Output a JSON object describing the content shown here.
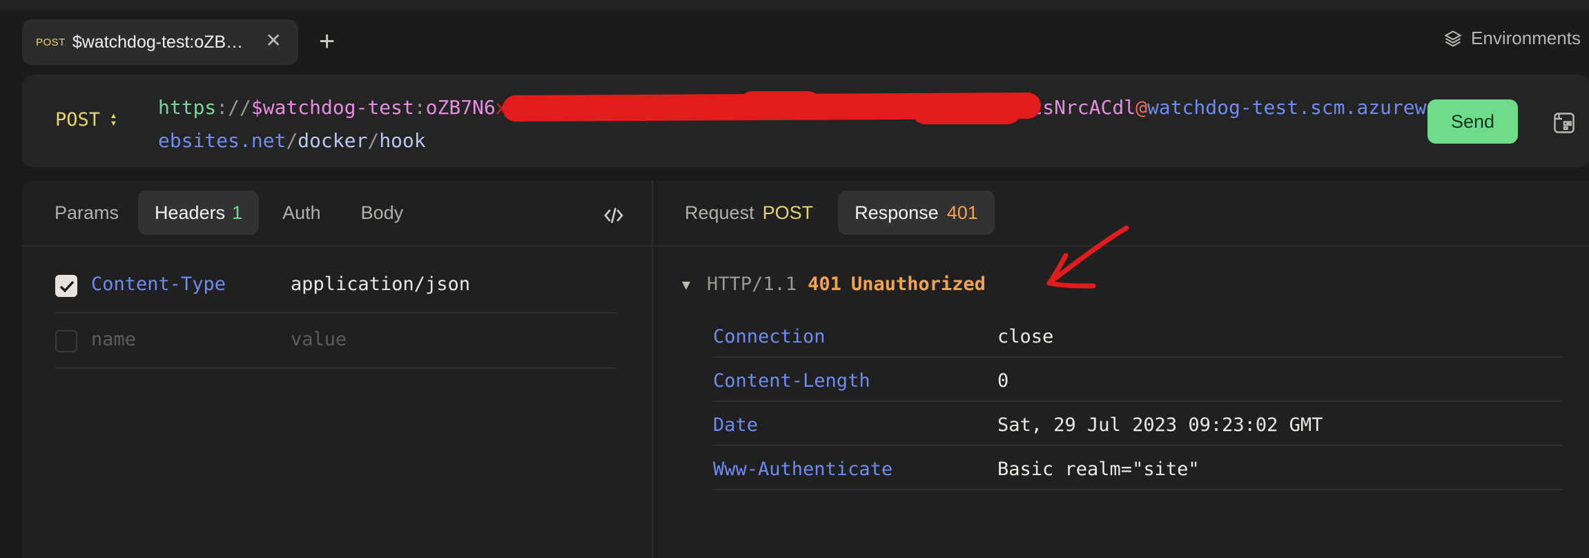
{
  "tab": {
    "method": "POST",
    "title": "$watchdog-test:oZB…"
  },
  "environments": {
    "label": "Environments"
  },
  "request": {
    "method": "POST",
    "url_parts": {
      "scheme": "https",
      "sep": "://",
      "user": "$watchdog-test",
      "colon": ":",
      "pass_start": "oZB7N6",
      "pass_end": "csNrcACdl",
      "at": "@",
      "host": "watchdog-test.scm.azurewebsites.net",
      "slash1": "/",
      "path1": "docker",
      "slash2": "/",
      "path2": "hook"
    },
    "send_label": "Send"
  },
  "left_tabs": {
    "params": "Params",
    "headers": "Headers",
    "headers_count": "1",
    "auth": "Auth",
    "body": "Body"
  },
  "headers": [
    {
      "key": "Content-Type",
      "value": "application/json",
      "enabled": true
    },
    {
      "key": "name",
      "value": "value",
      "enabled": false,
      "placeholder": true
    }
  ],
  "right_tabs": {
    "request": "Request",
    "request_method": "POST",
    "response": "Response",
    "response_code": "401"
  },
  "response": {
    "protocol": "HTTP/1.1",
    "status_code": "401",
    "status_text": "Unauthorized",
    "headers": [
      {
        "key": "Connection",
        "value": "close"
      },
      {
        "key": "Content-Length",
        "value": "0"
      },
      {
        "key": "Date",
        "value": "Sat, 29 Jul 2023 09:23:02 GMT"
      },
      {
        "key": "Www-Authenticate",
        "value": "Basic realm=\"site\""
      }
    ]
  },
  "colors": {
    "accent_green": "#6fdc8c",
    "method_yellow": "#e6d66d",
    "status_orange": "#f0a350",
    "key_blue": "#6e8cf0",
    "annotation_red": "#e21c1c"
  }
}
